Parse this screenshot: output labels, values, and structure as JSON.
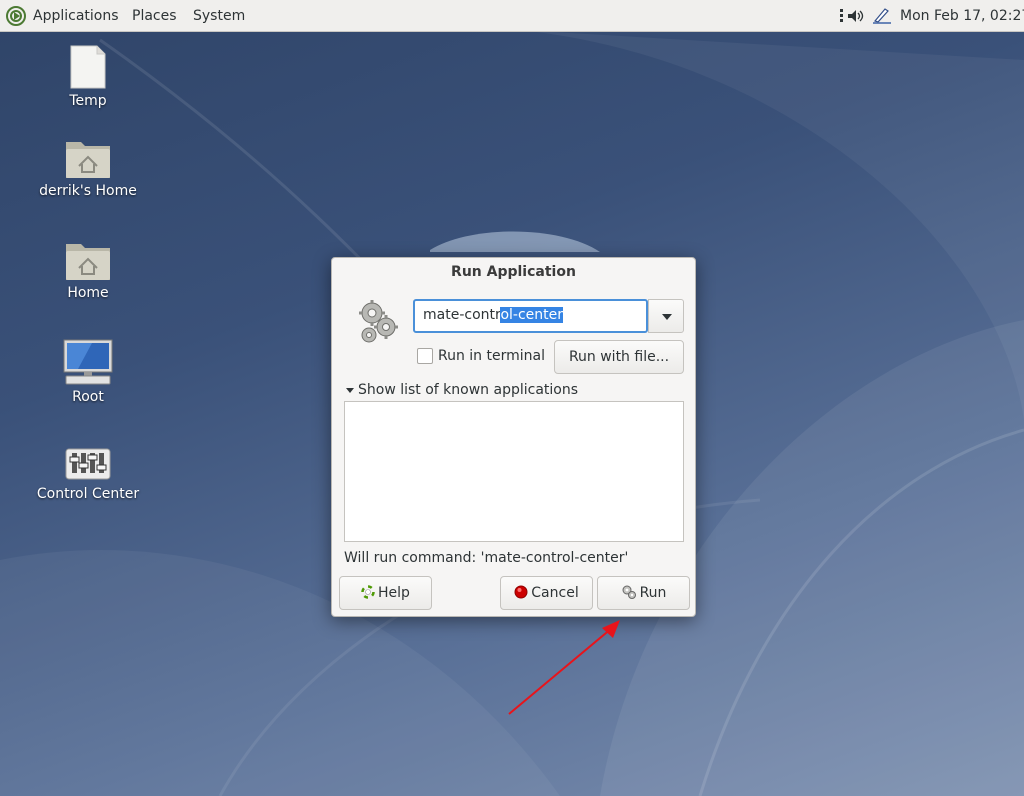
{
  "panel": {
    "menus": {
      "applications": "Applications",
      "places": "Places",
      "system": "System"
    },
    "clock": "Mon Feb 17, 02:27",
    "tray_icons": [
      "network-icon",
      "volume-icon",
      "update-notifier-icon"
    ]
  },
  "desktop_icons": [
    {
      "name": "temp",
      "label": "Temp",
      "icon": "file-icon"
    },
    {
      "name": "derriks-home",
      "label": "derrik's Home",
      "icon": "home-folder-icon"
    },
    {
      "name": "home",
      "label": "Home",
      "icon": "home-folder-icon"
    },
    {
      "name": "root",
      "label": "Root",
      "icon": "computer-icon"
    },
    {
      "name": "control-center",
      "label": "Control Center",
      "icon": "control-center-icon"
    }
  ],
  "dialog": {
    "title": "Run Application",
    "command": {
      "unselected_text": "mate-contr",
      "selected_text": "ol-center"
    },
    "run_in_terminal": {
      "label": "Run in terminal",
      "checked": false
    },
    "run_with_file_label": "Run with file...",
    "known_apps_toggle_label": "Show list of known applications",
    "will_run_text": "Will run command: 'mate-control-center'",
    "buttons": {
      "help": "Help",
      "cancel": "Cancel",
      "run": "Run"
    }
  },
  "colors": {
    "selection": "#3584e4",
    "focus_border": "#4a90d9",
    "annotation_arrow": "#e8141b"
  }
}
